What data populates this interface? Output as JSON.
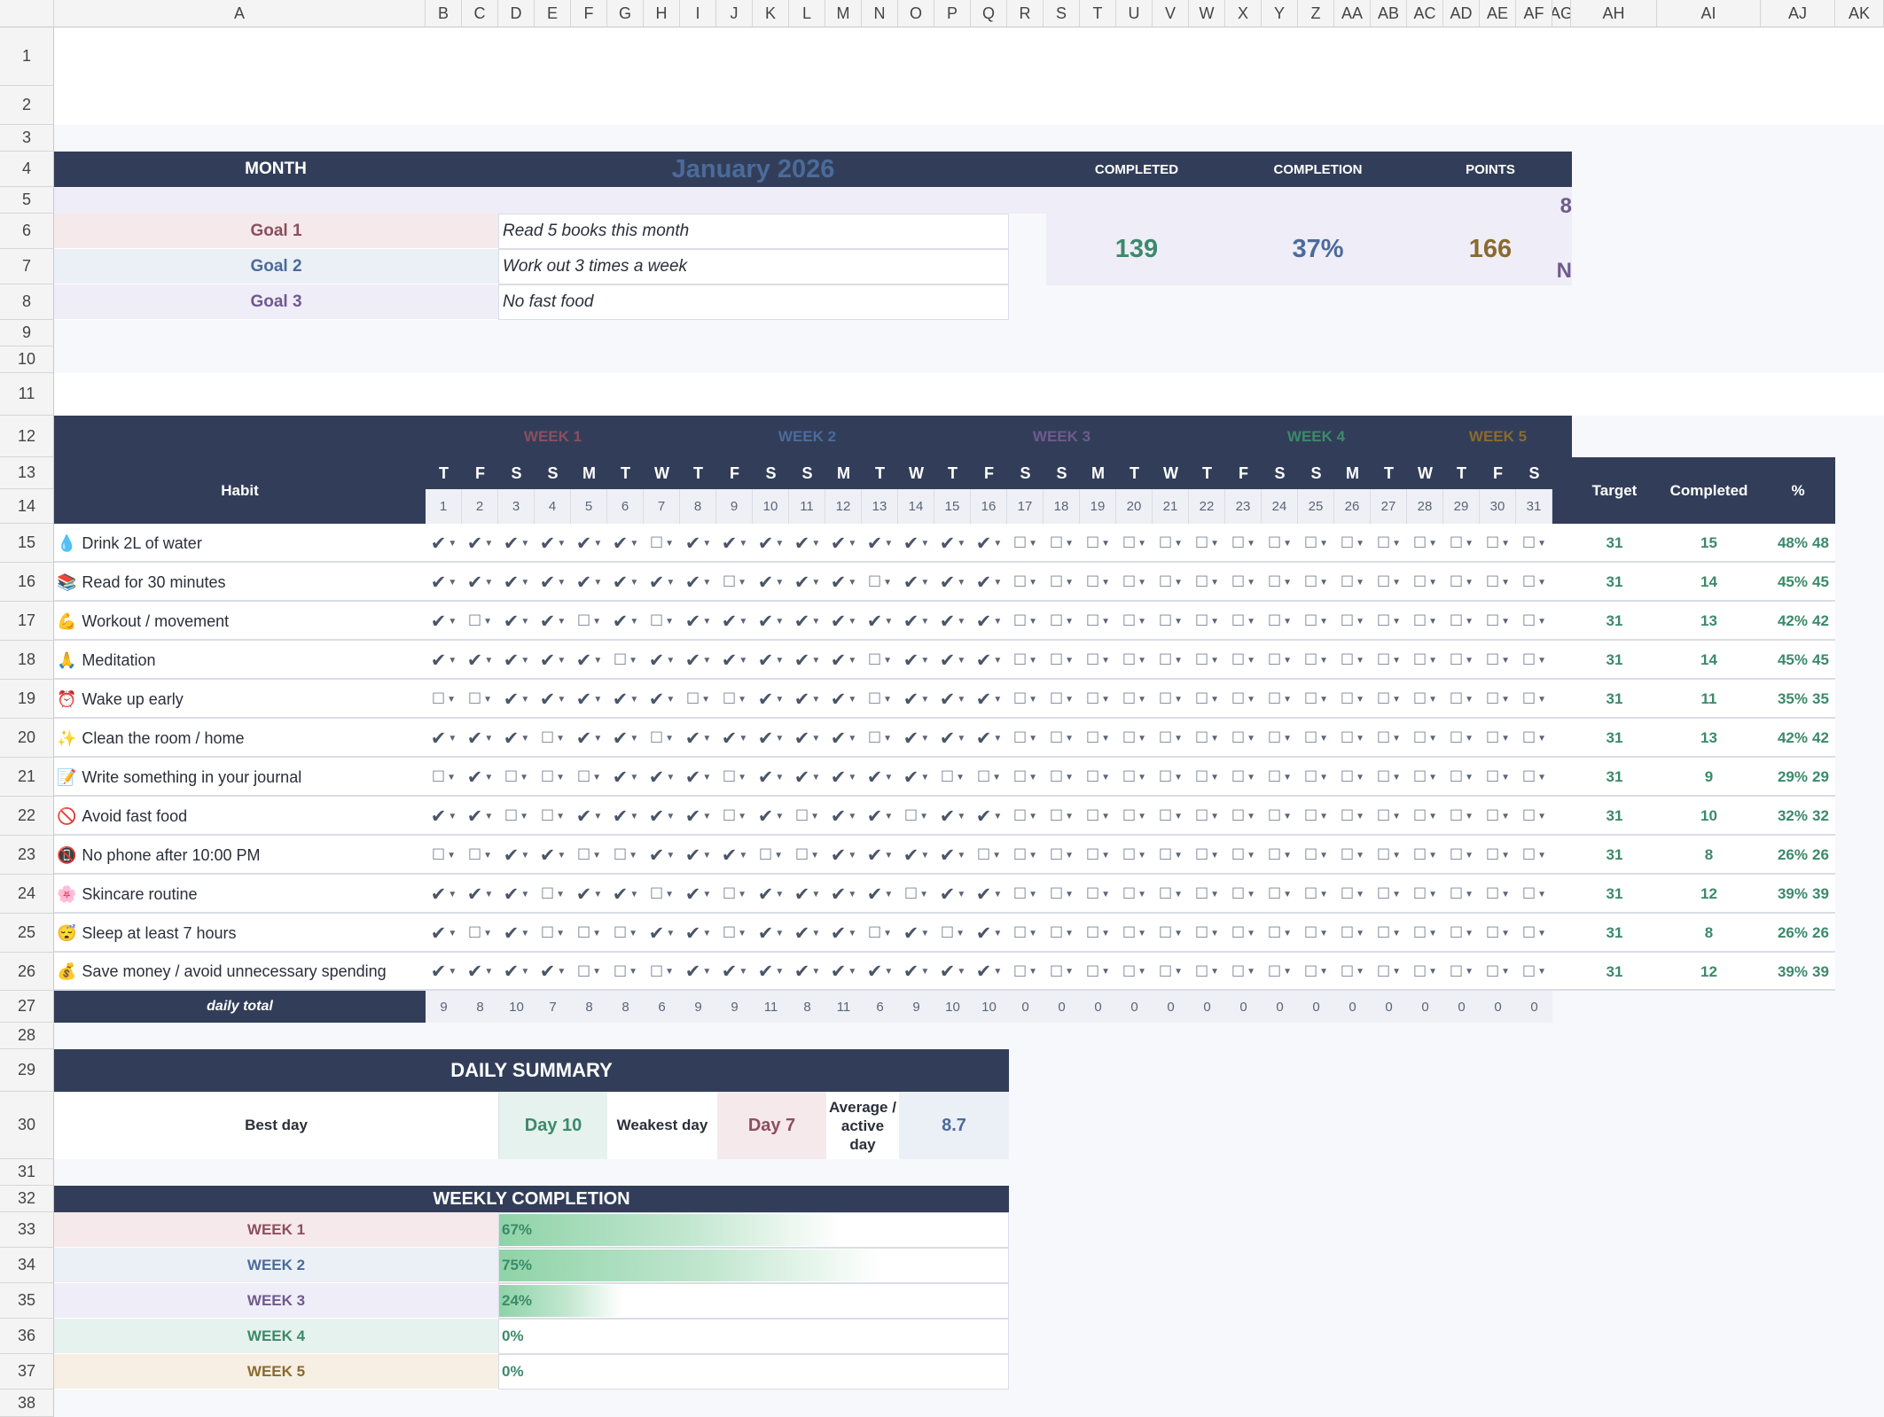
{
  "colors": {
    "navy": "#323e59",
    "week1": "#8b4f5e",
    "week2": "#4b6b9a",
    "week3": "#6f5a8e",
    "week4": "#3b8a6a",
    "week5": "#8a6a2e",
    "green_text": "#3b8a6a",
    "bar_green": "#8fd3a8"
  },
  "sheet": {
    "columns": [
      "A",
      "B",
      "C",
      "D",
      "E",
      "F",
      "G",
      "H",
      "I",
      "J",
      "K",
      "L",
      "M",
      "N",
      "O",
      "P",
      "Q",
      "R",
      "S",
      "T",
      "U",
      "V",
      "W",
      "X",
      "Y",
      "Z",
      "AA",
      "AB",
      "AC",
      "AD",
      "AE",
      "AF",
      "AG",
      "AH",
      "AI",
      "AJ",
      "AK"
    ],
    "rows": [
      "1",
      "2",
      "3",
      "4",
      "5",
      "6",
      "7",
      "8",
      "9",
      "10",
      "11",
      "12",
      "13",
      "14",
      "15",
      "16",
      "17",
      "18",
      "19",
      "20",
      "21",
      "22",
      "23",
      "24",
      "25",
      "26",
      "27",
      "28",
      "29",
      "30",
      "31",
      "32",
      "33",
      "34",
      "35",
      "36",
      "37",
      "38"
    ]
  },
  "header": {
    "month_label": "MONTH",
    "month_value": "January 2026",
    "completed_label": "COMPLETED",
    "completion_label": "COMPLETION",
    "points_label": "POINTS",
    "completed_value": "139",
    "completion_value": "37%",
    "points_value": "166",
    "overflow_top": "8",
    "overflow_bottom": "N"
  },
  "goals": [
    {
      "label": "Goal 1",
      "text": "Read 5 books this month"
    },
    {
      "label": "Goal 2",
      "text": "Work out 3 times a week"
    },
    {
      "label": "Goal 3",
      "text": "No fast food"
    }
  ],
  "tracker": {
    "habit_header": "Habit",
    "target_header": "Target",
    "completed_header": "Completed",
    "pct_header": "%",
    "weeks": [
      "WEEK 1",
      "WEEK 2",
      "WEEK 3",
      "WEEK 4",
      "WEEK 5"
    ],
    "day_letters": [
      "T",
      "F",
      "S",
      "S",
      "M",
      "T",
      "W",
      "T",
      "F",
      "S",
      "S",
      "M",
      "T",
      "W",
      "T",
      "F",
      "S",
      "S",
      "M",
      "T",
      "W",
      "T",
      "F",
      "S",
      "S",
      "M",
      "T",
      "W",
      "T",
      "F",
      "S"
    ],
    "day_numbers": [
      "1",
      "2",
      "3",
      "4",
      "5",
      "6",
      "7",
      "8",
      "9",
      "10",
      "11",
      "12",
      "13",
      "14",
      "15",
      "16",
      "17",
      "18",
      "19",
      "20",
      "21",
      "22",
      "23",
      "24",
      "25",
      "26",
      "27",
      "28",
      "29",
      "30",
      "31"
    ],
    "habits": [
      {
        "icon": "💧",
        "name": "Drink 2L of water",
        "target": "31",
        "completed": "15",
        "pct": "48%",
        "pct_overflow": "48",
        "checks": "1111110111111111000000000000000"
      },
      {
        "icon": "📚",
        "name": "Read for 30 minutes",
        "target": "31",
        "completed": "14",
        "pct": "45%",
        "pct_overflow": "45",
        "checks": "1111111101110111000000000000000"
      },
      {
        "icon": "💪",
        "name": "Workout / movement",
        "target": "31",
        "completed": "13",
        "pct": "42%",
        "pct_overflow": "42",
        "checks": "1011010111111111000000000000000"
      },
      {
        "icon": "🙏",
        "name": "Meditation",
        "target": "31",
        "completed": "14",
        "pct": "45%",
        "pct_overflow": "45",
        "checks": "1111101111110111000000000000000"
      },
      {
        "icon": "⏰",
        "name": "Wake up early",
        "target": "31",
        "completed": "11",
        "pct": "35%",
        "pct_overflow": "35",
        "checks": "0011111001110111000000000000000"
      },
      {
        "icon": "✨",
        "name": "Clean the room / home",
        "target": "31",
        "completed": "13",
        "pct": "42%",
        "pct_overflow": "42",
        "checks": "1110110111110111000000000000000"
      },
      {
        "icon": "📝",
        "name": "Write something in your journal",
        "target": "31",
        "completed": "9",
        "pct": "29%",
        "pct_overflow": "29",
        "checks": "0100011101111100000000000000000"
      },
      {
        "icon": "🚫",
        "name": "Avoid fast food",
        "target": "31",
        "completed": "10",
        "pct": "32%",
        "pct_overflow": "32",
        "checks": "1100111101011011000000000000000"
      },
      {
        "icon": "📵",
        "name": "No phone after 10:00 PM",
        "target": "31",
        "completed": "8",
        "pct": "26%",
        "pct_overflow": "26",
        "checks": "0011001110011110000000000000000"
      },
      {
        "icon": "🌸",
        "name": "Skincare routine",
        "target": "31",
        "completed": "12",
        "pct": "39%",
        "pct_overflow": "39",
        "checks": "1110110101111011000000000000000"
      },
      {
        "icon": "😴",
        "name": "Sleep at least 7 hours",
        "target": "31",
        "completed": "8",
        "pct": "26%",
        "pct_overflow": "26",
        "checks": "1010001101110101000000000000000"
      },
      {
        "icon": "💰",
        "name": "Save money / avoid unnecessary spending",
        "target": "31",
        "completed": "12",
        "pct": "39%",
        "pct_overflow": "39",
        "checks": "1111000111111111000000000000000"
      }
    ],
    "daily_total_label": "daily total",
    "daily_totals": [
      "9",
      "8",
      "10",
      "7",
      "8",
      "8",
      "6",
      "9",
      "9",
      "11",
      "8",
      "11",
      "6",
      "9",
      "10",
      "10",
      "0",
      "0",
      "0",
      "0",
      "0",
      "0",
      "0",
      "0",
      "0",
      "0",
      "0",
      "0",
      "0",
      "0",
      "0"
    ]
  },
  "daily_summary": {
    "title": "DAILY SUMMARY",
    "best_label": "Best day",
    "best_value": "Day 10",
    "weakest_label": "Weakest day",
    "weakest_value": "Day 7",
    "avg_label": "Average / active day",
    "avg_value": "8.7"
  },
  "weekly_completion": {
    "title": "WEEKLY COMPLETION",
    "weeks": [
      {
        "label": "WEEK 1",
        "value": "67%",
        "fraction": 0.67
      },
      {
        "label": "WEEK 2",
        "value": "75%",
        "fraction": 0.75
      },
      {
        "label": "WEEK 3",
        "value": "24%",
        "fraction": 0.24
      },
      {
        "label": "WEEK 4",
        "value": "0%",
        "fraction": 0
      },
      {
        "label": "WEEK 5",
        "value": "0%",
        "fraction": 0
      }
    ]
  }
}
